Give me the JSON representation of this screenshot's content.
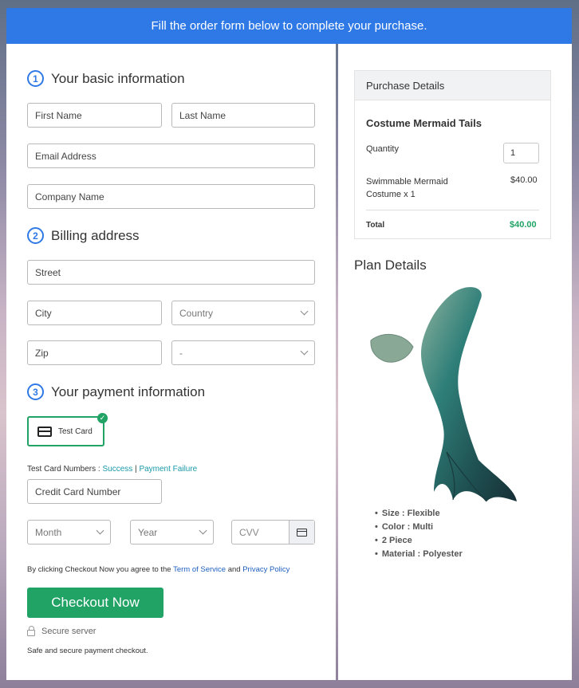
{
  "banner": {
    "text": "Fill the order form below to complete your purchase."
  },
  "sections": {
    "basic": {
      "num": "1",
      "title": "Your basic information"
    },
    "billing": {
      "num": "2",
      "title": "Billing address"
    },
    "payment": {
      "num": "3",
      "title": "Your payment information"
    }
  },
  "fields": {
    "first_name": "First Name",
    "last_name": "Last Name",
    "email": "Email Address",
    "company": "Company Name",
    "street": "Street",
    "city": "City",
    "country": "Country",
    "zip": "Zip",
    "state": "-",
    "card_number": "Credit Card Number",
    "month": "Month",
    "year": "Year",
    "cvv": "CVV"
  },
  "payment": {
    "card_option": "Test Card",
    "test_numbers_label": "Test Card Numbers : ",
    "success_link": "Success",
    "separator": " | ",
    "failure_link": "Payment Failure"
  },
  "agreement": {
    "prefix": "By clicking Checkout Now you agree to the ",
    "terms": "Term of Service",
    "and": " and ",
    "privacy": "Privacy Policy"
  },
  "checkout": {
    "button": "Checkout Now",
    "secure": "Secure server",
    "safe_text": "Safe and secure payment checkout."
  },
  "purchase": {
    "header": "Purchase Details",
    "product": "Costume Mermaid Tails",
    "quantity_label": "Quantity",
    "quantity_value": "1",
    "item_line1": "Swimmable Mermaid",
    "item_line2": "Costume x 1",
    "item_price": "$40.00",
    "total_label": "Total",
    "total_value": "$40.00"
  },
  "plan": {
    "title": "Plan Details",
    "items": [
      "Size : Flexible",
      "Color : Multi",
      "2 Piece",
      "Material : Polyester"
    ]
  },
  "colors": {
    "accent_blue": "#2f79e6",
    "success_green": "#21a366",
    "link_teal": "#1a9aa8"
  }
}
